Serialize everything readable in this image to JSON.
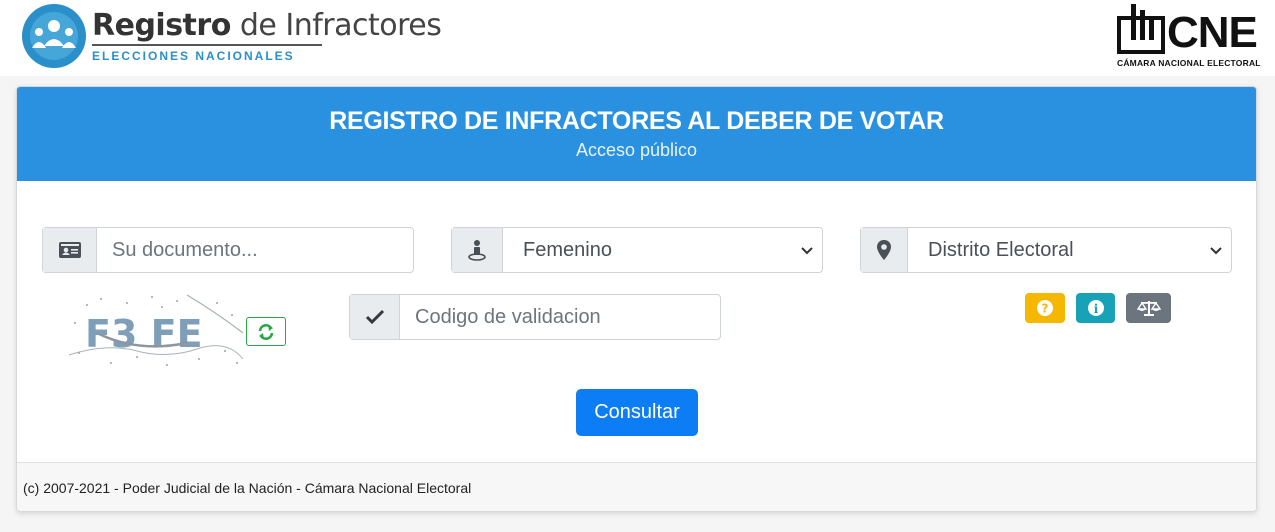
{
  "header": {
    "logo_title_bold": "Registro",
    "logo_title_rest": " de Infractores",
    "logo_subtitle": "ELECCIONES NACIONALES",
    "cne_logo": "CNE",
    "cne_logo_sub": "CÁMARA NACIONAL ELECTORAL"
  },
  "card": {
    "title": "REGISTRO DE INFRACTORES AL DEBER DE VOTAR",
    "subtitle": "Acceso público"
  },
  "form": {
    "document_placeholder": "Su documento...",
    "document_icon": "id-card-icon",
    "sex_icon": "person-icon",
    "sex_selected": "Femenino",
    "district_icon": "map-marker-icon",
    "district_selected": "Distrito Electoral",
    "captcha_text": "F3 FE",
    "validation_placeholder": "Codigo de validacion",
    "validation_icon": "check-icon",
    "submit_label": "Consultar"
  },
  "help_buttons": [
    {
      "icon": "question-icon",
      "color": "#f5b700"
    },
    {
      "icon": "info-icon",
      "color": "#17a2b8"
    },
    {
      "icon": "balance-scale-icon",
      "color": "#6c757d"
    }
  ],
  "colors": {
    "header_blue": "#2991e0",
    "button_blue": "#0d7df5",
    "refresh_green": "#28a745"
  },
  "footer": {
    "text": "(c) 2007-2021 - Poder Judicial de la Nación - Cámara Nacional Electoral"
  }
}
